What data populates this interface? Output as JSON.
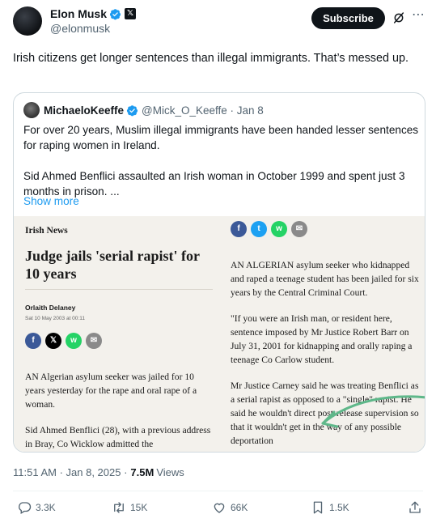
{
  "author": {
    "display_name": "Elon Musk",
    "handle": "@elonmusk",
    "x_badge": "𝕏"
  },
  "actions_header": {
    "subscribe_label": "Subscribe",
    "more_icon": "⋯"
  },
  "tweet": {
    "text": "Irish citizens get longer sentences than illegal immigrants. That’s messed up."
  },
  "quote": {
    "display_name": "MichaeloKeeffe",
    "handle_date": "@Mick_O_Keeffe · Jan 8",
    "paragraphs": [
      "For over 20 years, Muslim illegal immigrants have been handed lesser sentences for raping women in Ireland.",
      "Sid Ahmed Benflici assaulted an Irish woman in October 1999 and spent just 3 months in prison. ..."
    ],
    "show_more": "Show more"
  },
  "article": {
    "section": "Irish News",
    "headline": "Judge jails 'serial rapist' for 10 years",
    "author": "Orlaith Delaney",
    "date": "Sat 10 May 2003 at 00:11",
    "share_left": [
      "f",
      "𝕏",
      "w",
      "✉"
    ],
    "share_right": [
      "f",
      "t",
      "w",
      "✉"
    ],
    "left_paragraphs": [
      "AN Algerian asylum seeker was jailed for 10 years yesterday for the rape and oral rape of a woman.",
      "Sid Ahmed Benflici (28), with a previous address in Bray, Co Wicklow admitted the"
    ],
    "right_paragraphs": [
      "AN ALGERIAN asylum seeker who kidnapped and raped a teenage student has been jailed for six years by the Central Criminal Court.",
      "\"If you were an Irish man, or resident here, sentence imposed by Mr Justice Robert Barr on July 31, 2001 for kidnapping and orally raping a teenage Co Carlow student.",
      "Mr Justice Carney said he was treating Benflici as a serial rapist as opposed to a \"single\" rapist. He said he wouldn't direct post-release supervision so that it wouldn't get in the way of any possible deportation"
    ]
  },
  "meta": {
    "timestamp": "11:51 AM · Jan 8, 2025 ·",
    "views_count": "7.5M",
    "views_label": "Views"
  },
  "stats": {
    "replies": "3.3K",
    "reposts": "15K",
    "likes": "66K",
    "bookmarks": "1.5K"
  },
  "colors": {
    "accent": "#1d9bf0",
    "text": "#0f1419",
    "secondary": "#536471",
    "highlight_arrow": "#5fb88a"
  }
}
